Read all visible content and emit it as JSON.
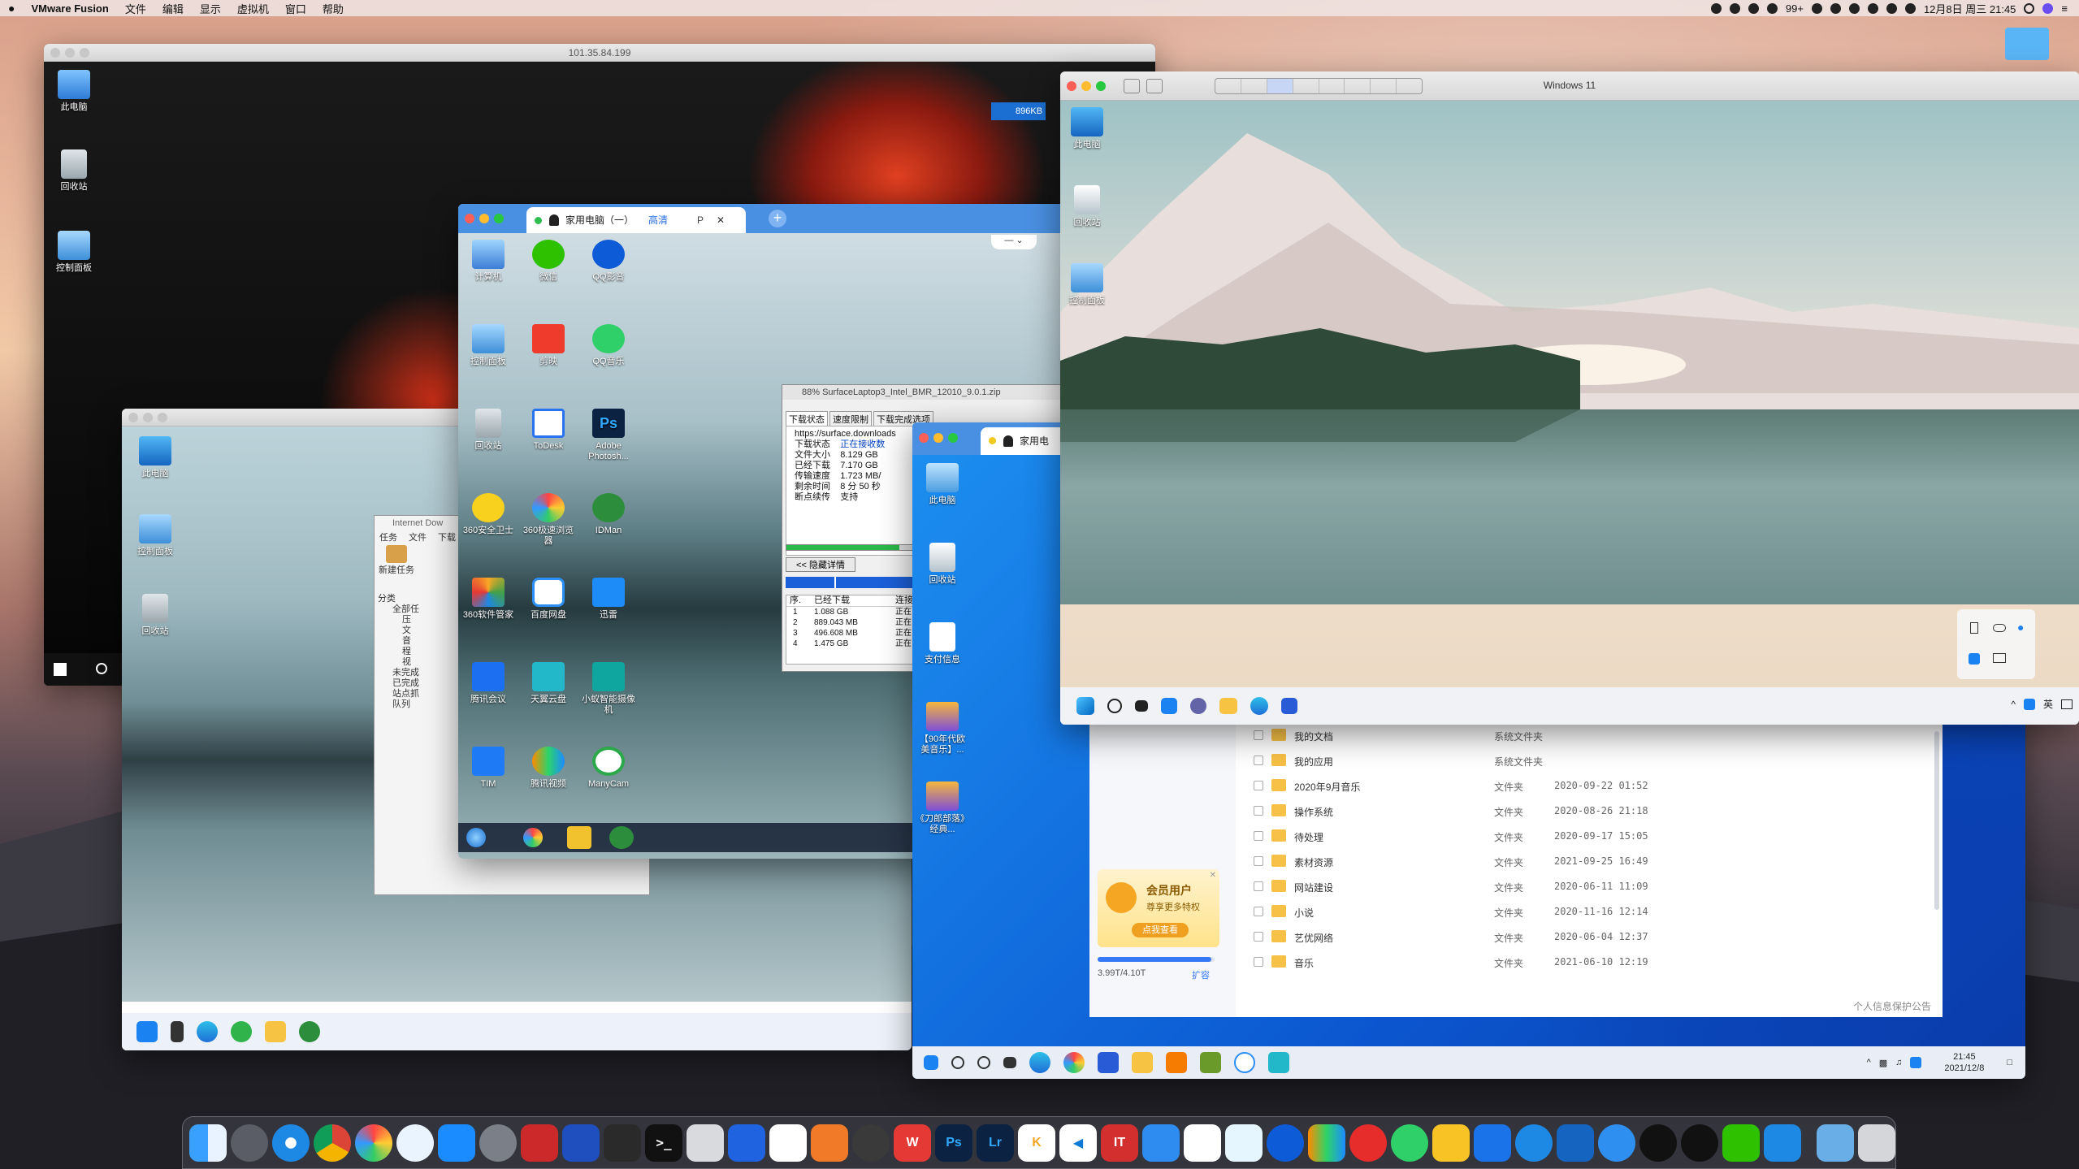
{
  "menubar": {
    "apple": "",
    "app_name": "VMware Fusion",
    "menus": [
      "文件",
      "编辑",
      "显示",
      "虚拟机",
      "窗口",
      "帮助"
    ],
    "badge": "99+",
    "clock": "12月8日 周三  21:45"
  },
  "vm1": {
    "title": "101.35.84.199",
    "speed_badge": "896KB",
    "icons": [
      {
        "label": "此电脑"
      },
      {
        "label": "回收站"
      },
      {
        "label": "控制面板"
      }
    ]
  },
  "vm2": {
    "icons": [
      {
        "label": "此电脑"
      },
      {
        "label": "控制面板"
      },
      {
        "label": "回收站"
      }
    ],
    "idm_title": "Internet Dow",
    "idm_menu": [
      "任务",
      "文件",
      "下载"
    ],
    "idm_btn": "新建任务",
    "idm_tree_title": "分类",
    "idm_tree": [
      "全部任",
      "压",
      "文",
      "音",
      "程",
      "视",
      "未完成",
      "已完成",
      "站点抓",
      "队列"
    ]
  },
  "rd_window": {
    "tab_title": "家用电脑（一）",
    "quality": "高清",
    "p_label": "P",
    "apps": [
      {
        "label": "计算机"
      },
      {
        "label": "微信"
      },
      {
        "label": "QQ影音"
      },
      {
        "label": "控制面板"
      },
      {
        "label": "剪映"
      },
      {
        "label": "QQ音乐"
      },
      {
        "label": "回收站"
      },
      {
        "label": "ToDesk"
      },
      {
        "label": "Adobe Photosh..."
      },
      {
        "label": "360安全卫士"
      },
      {
        "label": "360极速浏览器"
      },
      {
        "label": "IDMan"
      },
      {
        "label": "360软件管家"
      },
      {
        "label": "百度网盘"
      },
      {
        "label": "迅雷"
      },
      {
        "label": "腾讯会议"
      },
      {
        "label": "天翼云盘"
      },
      {
        "label": "小蚁智能摄像机"
      },
      {
        "label": "TIM"
      },
      {
        "label": "腾讯视频"
      },
      {
        "label": "ManyCam"
      }
    ]
  },
  "download": {
    "title": "88% SurfaceLaptop3_Intel_BMR_12010_9.0.1.zip",
    "tabs": [
      "下载状态",
      "速度限制",
      "下载完成选项"
    ],
    "url": "https://surface.downloads",
    "rows": [
      {
        "k": "下载状态",
        "v": "正在接收数"
      },
      {
        "k": "文件大小",
        "v": "8.129  GB"
      },
      {
        "k": "已经下载",
        "v": "7.170  GB"
      },
      {
        "k": "传输速度",
        "v": "1.723  MB/"
      },
      {
        "k": "剩余时间",
        "v": "8 分 50 秒"
      },
      {
        "k": "断点续传",
        "v": "支持"
      }
    ],
    "hide_btn": "<< 隐藏详情",
    "cols": [
      "序.",
      "已经下载",
      "连接"
    ],
    "parts": [
      {
        "n": "1",
        "v": "1.088  GB",
        "s": "正在"
      },
      {
        "n": "2",
        "v": "889.043  MB",
        "s": "正在"
      },
      {
        "n": "3",
        "v": "496.608  MB",
        "s": "正在"
      },
      {
        "n": "4",
        "v": "1.475  GB",
        "s": "正在"
      }
    ]
  },
  "blue_vm": {
    "tab_title": "家用电",
    "icons": [
      {
        "label": "此电脑"
      },
      {
        "label": "回收站"
      },
      {
        "label": "支付信息"
      },
      {
        "label": "【90年代欧美音乐】..."
      },
      {
        "label": "《刀郎部落》经典..."
      }
    ],
    "files": [
      {
        "name": "我的文档",
        "type": "系统文件夹",
        "date": ""
      },
      {
        "name": "我的应用",
        "type": "系统文件夹",
        "date": ""
      },
      {
        "name": "2020年9月音乐",
        "type": "文件夹",
        "date": "2020-09-22 01:52"
      },
      {
        "name": "操作系统",
        "type": "文件夹",
        "date": "2020-08-26 21:18"
      },
      {
        "name": "待处理",
        "type": "文件夹",
        "date": "2020-09-17 15:05"
      },
      {
        "name": "素材资源",
        "type": "文件夹",
        "date": "2021-09-25 16:49"
      },
      {
        "name": "网站建设",
        "type": "文件夹",
        "date": "2020-06-11 11:09"
      },
      {
        "name": "小说",
        "type": "文件夹",
        "date": "2020-11-16 12:14"
      },
      {
        "name": "艺优网络",
        "type": "文件夹",
        "date": "2020-06-04 12:37"
      },
      {
        "name": "音乐",
        "type": "文件夹",
        "date": "2021-06-10 12:19"
      }
    ],
    "vip_title": "会员用户",
    "vip_sub": "尊享更多特权",
    "vip_btn": "点我查看",
    "storage": "3.99T/4.10T",
    "expand": "扩容",
    "notice": "个人信息保护公告",
    "clock_time": "21:45",
    "clock_date": "2021/12/8"
  },
  "win11": {
    "title": "Windows 11",
    "icons": [
      {
        "label": "此电脑"
      },
      {
        "label": "回收站"
      },
      {
        "label": "控制面板"
      }
    ],
    "ime": "英"
  },
  "colors": {
    "win_blue": "#1e88e5",
    "accent": "#3478f6"
  }
}
